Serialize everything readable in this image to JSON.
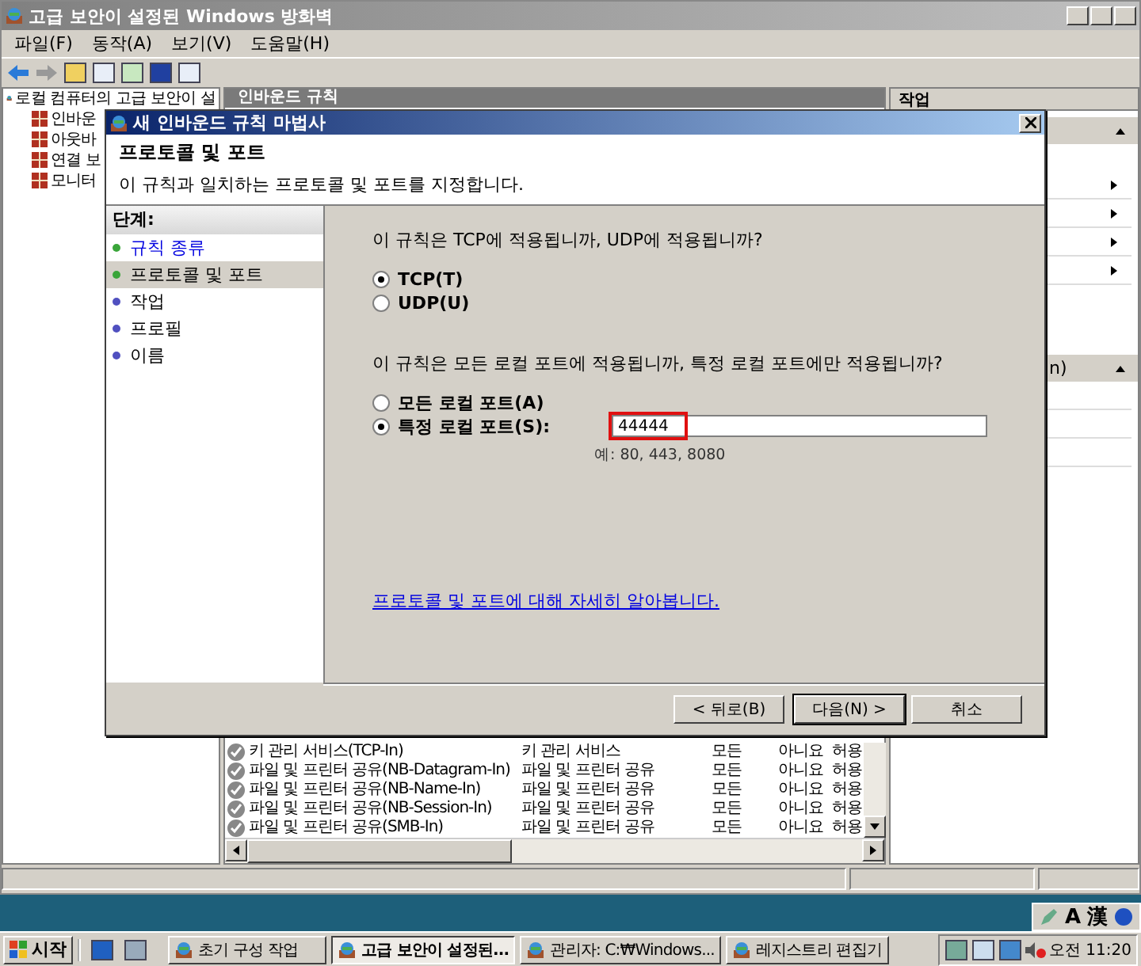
{
  "window": {
    "title": "고급 보안이 설정된 Windows 방화벽"
  },
  "menu": [
    "파일(F)",
    "동작(A)",
    "보기(V)",
    "도움말(H)"
  ],
  "tree": {
    "root": "로컬 컴퓨터의 고급 보안이 설",
    "children": [
      "인바운",
      "아웃바",
      "연결 보",
      "모니터"
    ]
  },
  "center": {
    "title": "인바운드 규칙",
    "rows": [
      {
        "name": "키 관리 서비스(TCP-In)",
        "group": "키 관리 서비스",
        "profile": "모든",
        "enabled": "아니요",
        "action": "허용"
      },
      {
        "name": "파일 및 프린터 공유(NB-Datagram-In)",
        "group": "파일 및 프린터 공유",
        "profile": "모든",
        "enabled": "아니요",
        "action": "허용"
      },
      {
        "name": "파일 및 프린터 공유(NB-Name-In)",
        "group": "파일 및 프린터 공유",
        "profile": "모든",
        "enabled": "아니요",
        "action": "허용"
      },
      {
        "name": "파일 및 프린터 공유(NB-Session-In)",
        "group": "파일 및 프린터 공유",
        "profile": "모든",
        "enabled": "아니요",
        "action": "허용"
      },
      {
        "name": "파일 및 프린터 공유(SMB-In)",
        "group": "파일 및 프린터 공유",
        "profile": "모든",
        "enabled": "아니요",
        "action": "허용"
      }
    ]
  },
  "actions_pane": {
    "title": "작업",
    "section_2": "n)"
  },
  "dialog": {
    "title": "새 인바운드 규칙 마법사",
    "heading": "프로토콜 및 포트",
    "subtitle": "이 규칙과 일치하는 프로토콜 및 포트를 지정합니다.",
    "steps_title": "단계:",
    "steps": [
      {
        "label": "규칙 종류",
        "kind": "link",
        "selected": false,
        "color": "#3aa53a"
      },
      {
        "label": "프로토콜 및 포트",
        "kind": "text",
        "selected": true,
        "color": "#3aa53a"
      },
      {
        "label": "작업",
        "kind": "text",
        "selected": false,
        "color": "#5050c0"
      },
      {
        "label": "프로필",
        "kind": "text",
        "selected": false,
        "color": "#5050c0"
      },
      {
        "label": "이름",
        "kind": "text",
        "selected": false,
        "color": "#5050c0"
      }
    ],
    "question_1": "이 규칙은 TCP에 적용됩니까, UDP에 적용됩니까?",
    "protocols": [
      {
        "label": "TCP(T)",
        "selected": true
      },
      {
        "label": "UDP(U)",
        "selected": false
      }
    ],
    "question_2": "이 규칙은 모든 로컬 포트에 적용됩니까, 특정 로컬 포트에만 적용됩니까?",
    "ports": [
      {
        "label": "모든 로컬 포트(A)",
        "kind": "plain",
        "selected": false
      },
      {
        "label": "특정 로컬 포트(S):",
        "kind": "field",
        "selected": true
      }
    ],
    "port_field": {
      "value": "44444",
      "hint": "예: 80, 443, 8080"
    },
    "link": "프로토콜 및 포트에 대해 자세히 알아봅니다.",
    "buttons": [
      {
        "label": "< 뒤로(B)",
        "default": false
      },
      {
        "label": "다음(N) >",
        "default": true
      },
      {
        "label": "취소",
        "default": false
      }
    ]
  },
  "language_bar": [
    "A",
    "漢"
  ],
  "taskbar": {
    "start": "시작",
    "tasks": [
      {
        "label": "초기 구성 작업",
        "selected": false
      },
      {
        "label": "고급 보안이 설정된...",
        "selected": true
      },
      {
        "label": "관리자: C:₩Windows...",
        "selected": false
      },
      {
        "label": "레지스트리 편집기",
        "selected": false
      }
    ],
    "clock": "오전 11:20"
  }
}
